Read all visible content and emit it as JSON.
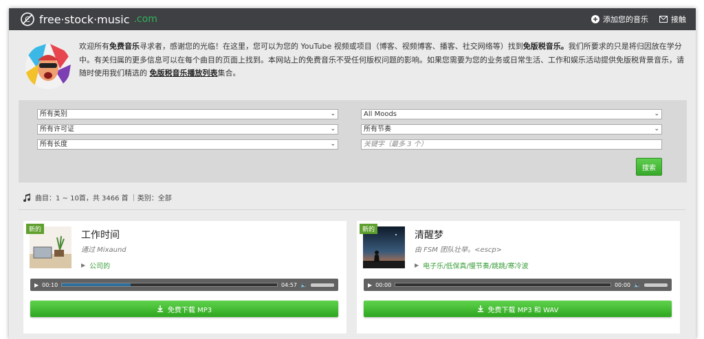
{
  "header": {
    "logo_main": "free·stock·music",
    "logo_domain": ".com",
    "nav": [
      {
        "label": "添加您的音乐",
        "icon": "plus-circle-icon"
      },
      {
        "label": "接触",
        "icon": "envelope-icon"
      }
    ]
  },
  "intro": {
    "p1": "欢迎所有",
    "b1": "免费音乐",
    "p2": "寻求者，感谢您的光临！在这里，您可以为您的 YouTube 视频或项目（博客、视频博客、播客、社交网络等）找到",
    "b2": "免版税音乐。",
    "p3": "我们所要求的只是将归因放在学分中。有关归属的更多信息可以在每个曲目的页面上找到。本网站上的免费音乐不受任何版权问题的影响。如果您需要为您的业务或日常生活、工作和娱乐活动提供免版税背景音乐，请随时使用我们精选的",
    "link": "免版税音乐播放列表",
    "p4": "集合。"
  },
  "filters": {
    "category": "所有类别",
    "license": "所有许可证",
    "length": "所有长度",
    "mood": "All Moods",
    "tempo": "所有节奏",
    "keyword_placeholder": "关键字（最多 3 个）",
    "search_label": "搜索"
  },
  "results": {
    "summary": "曲目：1 ~ 10首，共 3466 首 ｜类别：全部"
  },
  "tracks": [
    {
      "badge": "新的",
      "title": "工作时间",
      "artist": "通过 Mixaund",
      "tags": "公司的",
      "time_current": "00:10",
      "time_total": "04:57",
      "progress": 0.32,
      "download_label": "免费下载 MP3"
    },
    {
      "badge": "新的",
      "title": "清醒梦",
      "artist": "由 FSM 团队壮举。<escp>",
      "tags": "电子乐/低保真/慢节奏/跳跳/寒冷波",
      "time_current": "00:00",
      "time_total": "00:00",
      "progress": 0,
      "download_label": "免费下载 MP3 和 WAV"
    }
  ],
  "colors": {
    "topbar": "#3f4043",
    "accent_green": "#3cb02e",
    "link_green": "#3b9d3b"
  }
}
